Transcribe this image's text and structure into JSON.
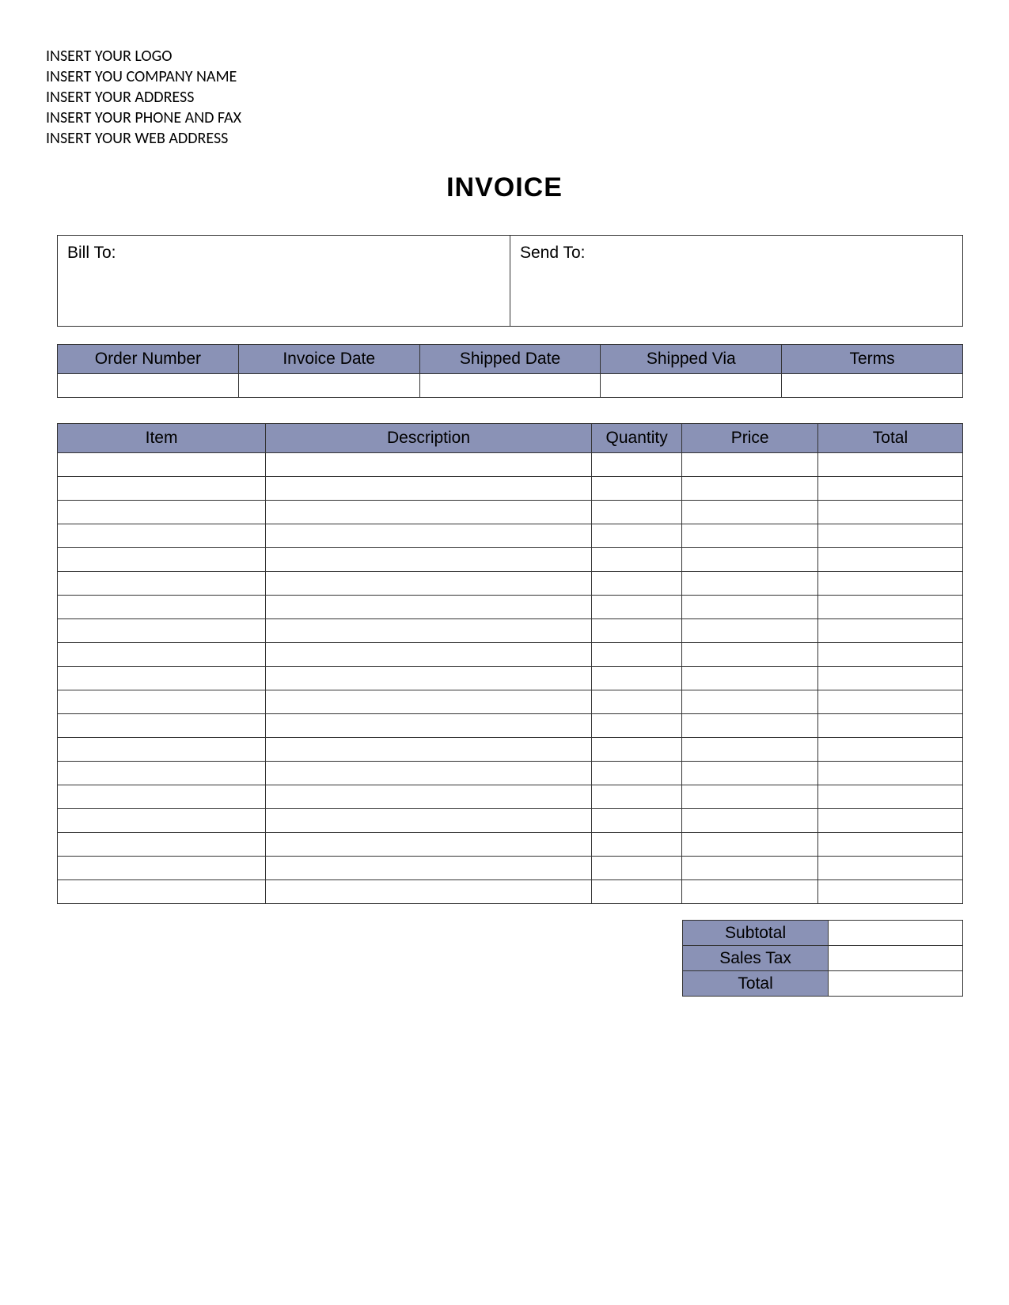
{
  "company": {
    "logo_line": "INSERT YOUR LOGO",
    "name_line": "INSERT YOU COMPANY NAME",
    "address_line": "INSERT YOUR ADDRESS",
    "phone_fax_line": "INSERT YOUR PHONE AND FAX",
    "web_line": "INSERT YOUR WEB ADDRESS"
  },
  "title": "INVOICE",
  "bill_send": {
    "bill_to_label": "Bill To:",
    "bill_to_value": "",
    "send_to_label": "Send To:",
    "send_to_value": ""
  },
  "order_headers": {
    "order_number": "Order Number",
    "invoice_date": "Invoice Date",
    "shipped_date": "Shipped Date",
    "shipped_via": "Shipped Via",
    "terms": "Terms"
  },
  "order_row": {
    "order_number": "",
    "invoice_date": "",
    "shipped_date": "",
    "shipped_via": "",
    "terms": ""
  },
  "items_headers": {
    "item": "Item",
    "description": "Description",
    "quantity": "Quantity",
    "price": "Price",
    "total": "Total"
  },
  "items": [
    {
      "item": "",
      "description": "",
      "quantity": "",
      "price": "",
      "total": ""
    },
    {
      "item": "",
      "description": "",
      "quantity": "",
      "price": "",
      "total": ""
    },
    {
      "item": "",
      "description": "",
      "quantity": "",
      "price": "",
      "total": ""
    },
    {
      "item": "",
      "description": "",
      "quantity": "",
      "price": "",
      "total": ""
    },
    {
      "item": "",
      "description": "",
      "quantity": "",
      "price": "",
      "total": ""
    },
    {
      "item": "",
      "description": "",
      "quantity": "",
      "price": "",
      "total": ""
    },
    {
      "item": "",
      "description": "",
      "quantity": "",
      "price": "",
      "total": ""
    },
    {
      "item": "",
      "description": "",
      "quantity": "",
      "price": "",
      "total": ""
    },
    {
      "item": "",
      "description": "",
      "quantity": "",
      "price": "",
      "total": ""
    },
    {
      "item": "",
      "description": "",
      "quantity": "",
      "price": "",
      "total": ""
    },
    {
      "item": "",
      "description": "",
      "quantity": "",
      "price": "",
      "total": ""
    },
    {
      "item": "",
      "description": "",
      "quantity": "",
      "price": "",
      "total": ""
    },
    {
      "item": "",
      "description": "",
      "quantity": "",
      "price": "",
      "total": ""
    },
    {
      "item": "",
      "description": "",
      "quantity": "",
      "price": "",
      "total": ""
    },
    {
      "item": "",
      "description": "",
      "quantity": "",
      "price": "",
      "total": ""
    },
    {
      "item": "",
      "description": "",
      "quantity": "",
      "price": "",
      "total": ""
    },
    {
      "item": "",
      "description": "",
      "quantity": "",
      "price": "",
      "total": ""
    },
    {
      "item": "",
      "description": "",
      "quantity": "",
      "price": "",
      "total": ""
    },
    {
      "item": "",
      "description": "",
      "quantity": "",
      "price": "",
      "total": ""
    }
  ],
  "summary": {
    "subtotal_label": "Subtotal",
    "subtotal_value": "",
    "salestax_label": "Sales Tax",
    "salestax_value": "",
    "total_label": "Total",
    "total_value": ""
  }
}
